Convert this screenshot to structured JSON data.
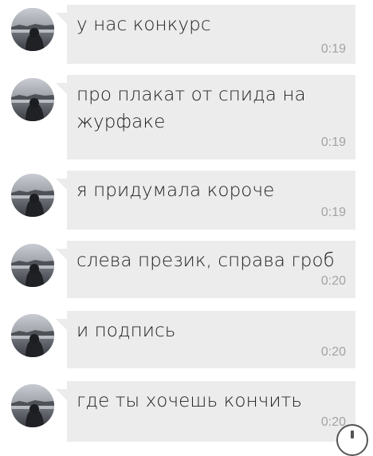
{
  "messages": [
    {
      "text": "у нас конкурс",
      "time": "0:19",
      "avatar_icon": "user-avatar-icon"
    },
    {
      "text": "про плакат от спида на журфаке",
      "time": "0:19",
      "avatar_icon": "user-avatar-icon"
    },
    {
      "text": "я придумала короче",
      "time": "0:19",
      "avatar_icon": "user-avatar-icon"
    },
    {
      "text": "слева презик, справа гроб",
      "time": "0:20",
      "avatar_icon": "user-avatar-icon"
    },
    {
      "text": "и подпись",
      "time": "0:20",
      "avatar_icon": "user-avatar-icon"
    },
    {
      "text": "где ты хочешь кончить",
      "time": "0:20",
      "avatar_icon": "user-avatar-icon"
    }
  ],
  "colors": {
    "bubble": "#ececec",
    "text": "#222222",
    "time": "#a3a3a3",
    "background": "#ffffff"
  }
}
